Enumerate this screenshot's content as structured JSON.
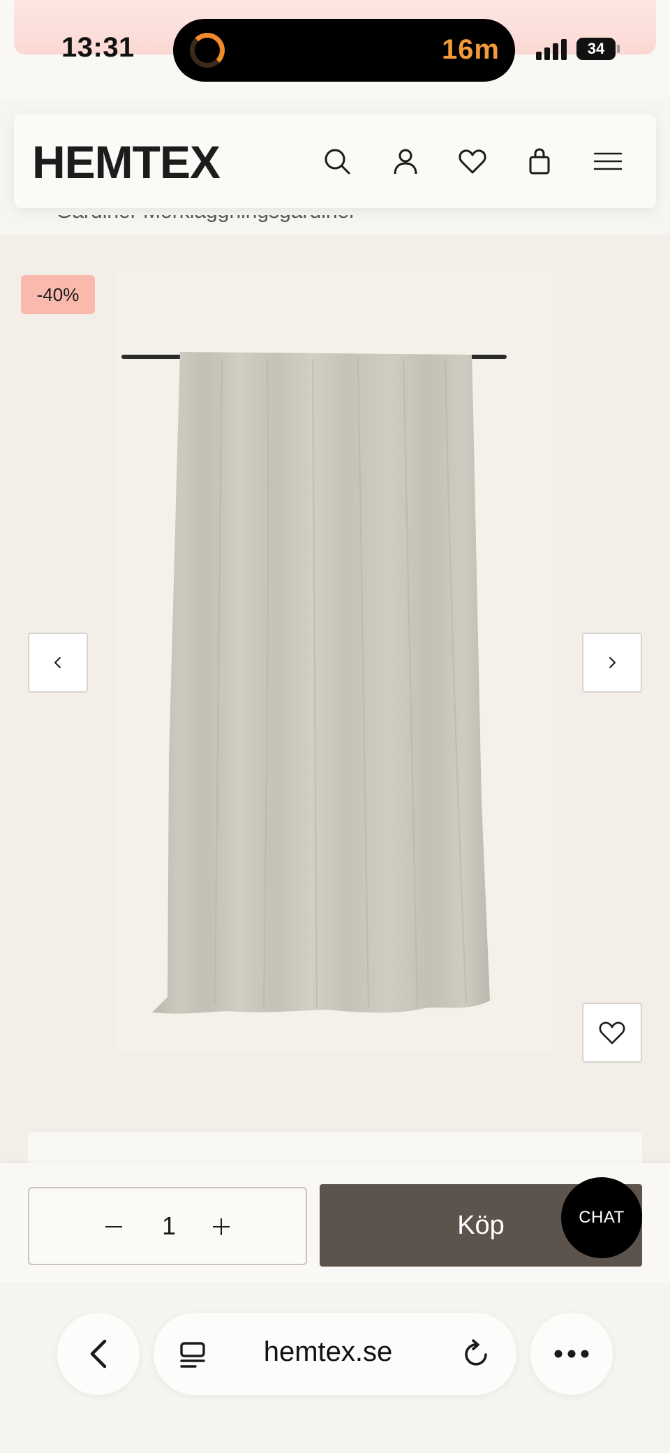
{
  "status_bar": {
    "time": "13:31",
    "timer": "16m",
    "battery": "34"
  },
  "header": {
    "logo": "HEMTEX",
    "icons": [
      "search-icon",
      "account-icon",
      "heart-icon",
      "bag-icon",
      "menu-icon"
    ],
    "breadcrumb_peek": "Gardiner       Mörkläggningsgardiner"
  },
  "product": {
    "discount_badge": "-40%",
    "image_alt": "Beige curtain hanging on a rod"
  },
  "buy_bar": {
    "quantity": "1",
    "buy_label": "Köp",
    "chat_label": "CHAT"
  },
  "browser": {
    "url": "hemtex.se"
  },
  "colors": {
    "badge": "#f9b9ad",
    "buy_button": "#5b534c",
    "background": "#f3efe8",
    "timer": "#f39a3b"
  }
}
